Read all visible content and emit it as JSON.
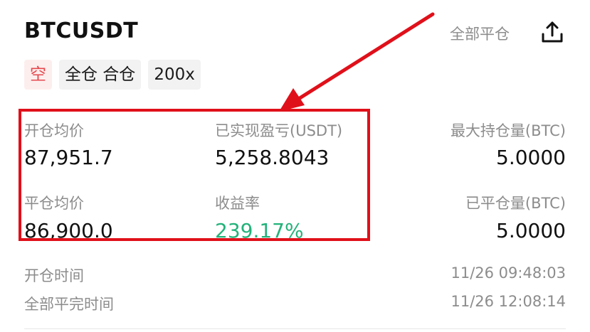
{
  "header": {
    "symbol": "BTCUSDT",
    "close_all_label": "全部平仓",
    "share_icon": "share-icon"
  },
  "tags": {
    "direction": "空",
    "margin_mode": "全仓 合仓",
    "leverage": "200x"
  },
  "stats": {
    "open_avg_label": "开仓均价",
    "open_avg_value": "87,951.7",
    "realized_pnl_label": "已实现盈亏(USDT)",
    "realized_pnl_value": "5,258.8043",
    "max_position_label": "最大持仓量(BTC)",
    "max_position_value": "5.0000",
    "close_avg_label": "平仓均价",
    "close_avg_value": "86,900.0",
    "roi_label": "收益率",
    "roi_value": "239.17%",
    "closed_qty_label": "已平仓量(BTC)",
    "closed_qty_value": "5.0000"
  },
  "times": {
    "open_time_label": "开仓时间",
    "open_time_value": "11/26 09:48:03",
    "close_time_label": "全部平完时间",
    "close_time_value": "11/26 12:08:14"
  },
  "colors": {
    "short_red": "#e5484d",
    "profit_green": "#23b27a",
    "annotation_red": "#e0101a"
  }
}
